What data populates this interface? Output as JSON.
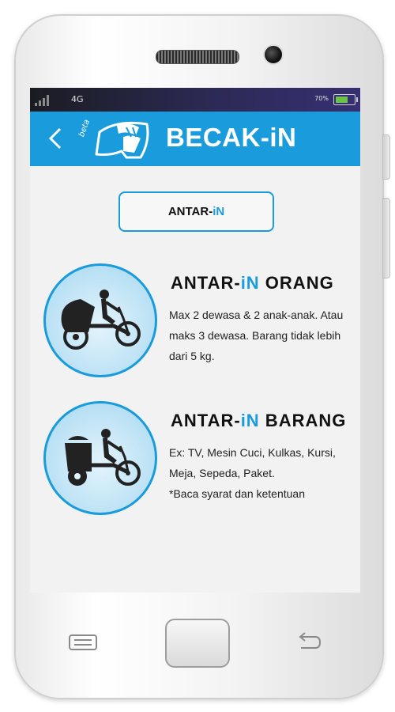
{
  "status": {
    "network": "4G",
    "battery": "70%",
    "battery_level": 0.7
  },
  "appbar": {
    "title": "BECAK-iN",
    "beta": "beta"
  },
  "tab": {
    "prefix": "ANTAR-",
    "highlight": "iN"
  },
  "cards": [
    {
      "title_prefix": "ANTAR-",
      "title_highlight": "iN",
      "title_suffix": " ORANG",
      "lines": [
        "Max 2 dewasa & 2 anak-anak. Atau",
        "maks 3 dewasa. Barang tidak lebih",
        "dari 5 kg."
      ]
    },
    {
      "title_prefix": "ANTAR-",
      "title_highlight": "iN",
      "title_suffix": " BARANG",
      "lines": [
        "Ex: TV, Mesin Cuci, Kulkas, Kursi,",
        "Meja, Sepeda, Paket.",
        "*Baca syarat dan ketentuan"
      ]
    }
  ],
  "colors": {
    "accent": "#1a9bdc",
    "status_bg": "#2c2a55",
    "text": "#111111"
  },
  "icons": [
    "back-icon",
    "becak-logo-icon",
    "becak-passenger-icon",
    "becak-cargo-icon",
    "menu-icon",
    "home-button",
    "back-nav-icon"
  ]
}
